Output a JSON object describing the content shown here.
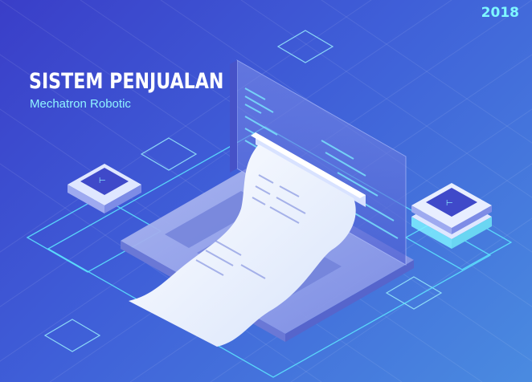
{
  "banner": {
    "title": "SISTEM PENJUALAN",
    "subtitle": "Mechatron Robotic",
    "year": "2018"
  },
  "colors": {
    "background_start": "#3a3ec8",
    "background_end": "#4a8be0",
    "title": "#ffffff",
    "subtitle": "#8ff3ff",
    "year": "#7ef7ff",
    "outline_glow": "#5ee8ff"
  },
  "icons": [
    "laptop-icon",
    "receipt-icon",
    "server-chip-icon",
    "grid-tile-icon"
  ]
}
